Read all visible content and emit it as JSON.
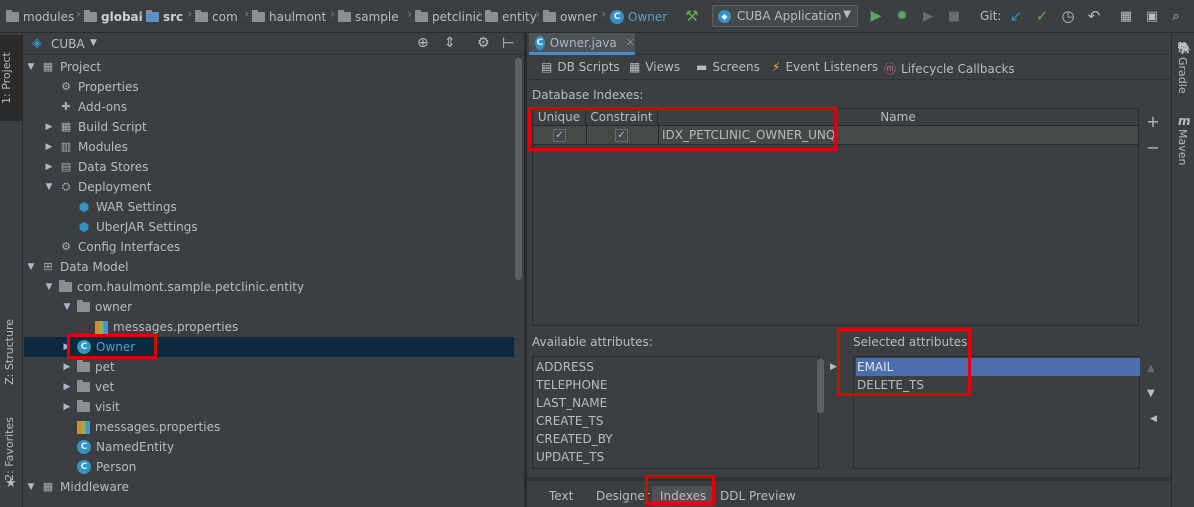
{
  "breadcrumbs": [
    {
      "label": "modules",
      "bold": false
    },
    {
      "label": "global",
      "bold": true
    },
    {
      "label": "src",
      "bold": true
    },
    {
      "label": "com",
      "bold": false
    },
    {
      "label": "haulmont",
      "bold": false
    },
    {
      "label": "sample",
      "bold": false
    },
    {
      "label": "petclinic",
      "bold": false
    },
    {
      "label": "entity",
      "bold": false
    },
    {
      "label": "owner",
      "bold": false
    },
    {
      "label": "Owner",
      "bold": false
    }
  ],
  "toolbar": {
    "run_config": "CUBA Application",
    "git_label": "Git:"
  },
  "left_strip": {
    "project_tab": "1: Project",
    "structure_tab": "Z: Structure",
    "favorites_tab": "2: Favorites"
  },
  "right_strip": {
    "gradle_tab": "Gradle",
    "maven_tab": "Maven"
  },
  "project_panel": {
    "view_selector": "CUBA"
  },
  "tree": [
    {
      "label": "Project",
      "level": 0,
      "arrow": "down",
      "icon": "grid"
    },
    {
      "label": "Properties",
      "level": 1,
      "arrow": "",
      "icon": "gear"
    },
    {
      "label": "Add-ons",
      "level": 1,
      "arrow": "",
      "icon": "puzzle"
    },
    {
      "label": "Build Script",
      "level": 1,
      "arrow": "right",
      "icon": "build"
    },
    {
      "label": "Modules",
      "level": 1,
      "arrow": "right",
      "icon": "modules"
    },
    {
      "label": "Data Stores",
      "level": 1,
      "arrow": "right",
      "icon": "db"
    },
    {
      "label": "Deployment",
      "level": 1,
      "arrow": "down",
      "icon": "deploy"
    },
    {
      "label": "WAR Settings",
      "level": 2,
      "arrow": "",
      "icon": "cube"
    },
    {
      "label": "UberJAR Settings",
      "level": 2,
      "arrow": "",
      "icon": "cube"
    },
    {
      "label": "Config Interfaces",
      "level": 1,
      "arrow": "",
      "icon": "gear"
    },
    {
      "label": "Data Model",
      "level": 0,
      "arrow": "down",
      "icon": "model"
    },
    {
      "label": "com.haulmont.sample.petclinic.entity",
      "level": 1,
      "arrow": "down",
      "icon": "folder"
    },
    {
      "label": "owner",
      "level": 2,
      "arrow": "down",
      "icon": "folder"
    },
    {
      "label": "messages.properties",
      "level": 3,
      "arrow": "",
      "icon": "bars"
    },
    {
      "label": "Owner",
      "level": 2,
      "arrow": "right",
      "icon": "class",
      "selected": true
    },
    {
      "label": "pet",
      "level": 2,
      "arrow": "right",
      "icon": "folder"
    },
    {
      "label": "vet",
      "level": 2,
      "arrow": "right",
      "icon": "folder"
    },
    {
      "label": "visit",
      "level": 2,
      "arrow": "right",
      "icon": "folder"
    },
    {
      "label": "messages.properties",
      "level": 2,
      "arrow": "",
      "icon": "bars"
    },
    {
      "label": "NamedEntity",
      "level": 2,
      "arrow": "",
      "icon": "class"
    },
    {
      "label": "Person",
      "level": 2,
      "arrow": "",
      "icon": "class"
    },
    {
      "label": "Middleware",
      "level": 0,
      "arrow": "down",
      "icon": "grid"
    }
  ],
  "editor": {
    "file_tab": "Owner.java",
    "tools": [
      "DB Scripts",
      "Views",
      "Screens",
      "Event Listeners",
      "Lifecycle Callbacks"
    ],
    "db_indexes_label": "Database Indexes:",
    "columns": [
      "Unique",
      "Constraint",
      "Name"
    ],
    "index_row": {
      "unique": "✓",
      "constraint": "✓",
      "name": "IDX_PETCLINIC_OWNER_UNQ"
    },
    "available_label": "Available attributes:",
    "available": [
      "ADDRESS",
      "TELEPHONE",
      "LAST_NAME",
      "CREATE_TS",
      "CREATED_BY",
      "UPDATE_TS"
    ],
    "selected_label": "Selected attributes:",
    "selected": [
      "EMAIL",
      "DELETE_TS"
    ],
    "bottom_tabs": [
      "Text",
      "Designer",
      "Indexes",
      "DDL Preview"
    ]
  }
}
